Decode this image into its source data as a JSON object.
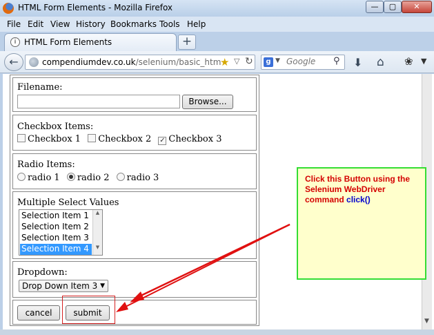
{
  "window": {
    "title": "HTML Form Elements - Mozilla Firefox",
    "controls": {
      "minimize": "—",
      "maximize": "▢",
      "close": "✕"
    }
  },
  "menu": [
    "File",
    "Edit",
    "View",
    "History",
    "Bookmarks",
    "Tools",
    "Help"
  ],
  "tab": {
    "label": "HTML Form Elements",
    "new_tab": "+"
  },
  "nav": {
    "url_host": "compendiumdev.co.uk",
    "url_path": "/selenium/basic_html_f",
    "search_placeholder": "Google"
  },
  "form": {
    "filename_label": "Filename:",
    "browse_label": "Browse...",
    "checkbox_label": "Checkbox Items:",
    "checkboxes": [
      {
        "label": "Checkbox 1",
        "checked": false
      },
      {
        "label": "Checkbox 2",
        "checked": false
      },
      {
        "label": "Checkbox 3",
        "checked": true
      }
    ],
    "radio_label": "Radio Items:",
    "radios": [
      {
        "label": "radio 1",
        "selected": false
      },
      {
        "label": "radio 2",
        "selected": true
      },
      {
        "label": "radio 3",
        "selected": false
      }
    ],
    "multiselect_label": "Multiple Select Values",
    "multiselect_options": [
      "Selection Item 1",
      "Selection Item 2",
      "Selection Item 3",
      "Selection Item 4"
    ],
    "multiselect_selected": "Selection Item 4",
    "dropdown_label": "Dropdown:",
    "dropdown_value": "Drop Down Item 3",
    "cancel_label": "cancel",
    "submit_label": "submit"
  },
  "annotation": {
    "text_before": "Click this Button using the Selenium WebDriver command ",
    "code": "click()",
    "border_color": "#33dd33",
    "text_color": "#d40000",
    "arrow_color": "#e01010"
  }
}
